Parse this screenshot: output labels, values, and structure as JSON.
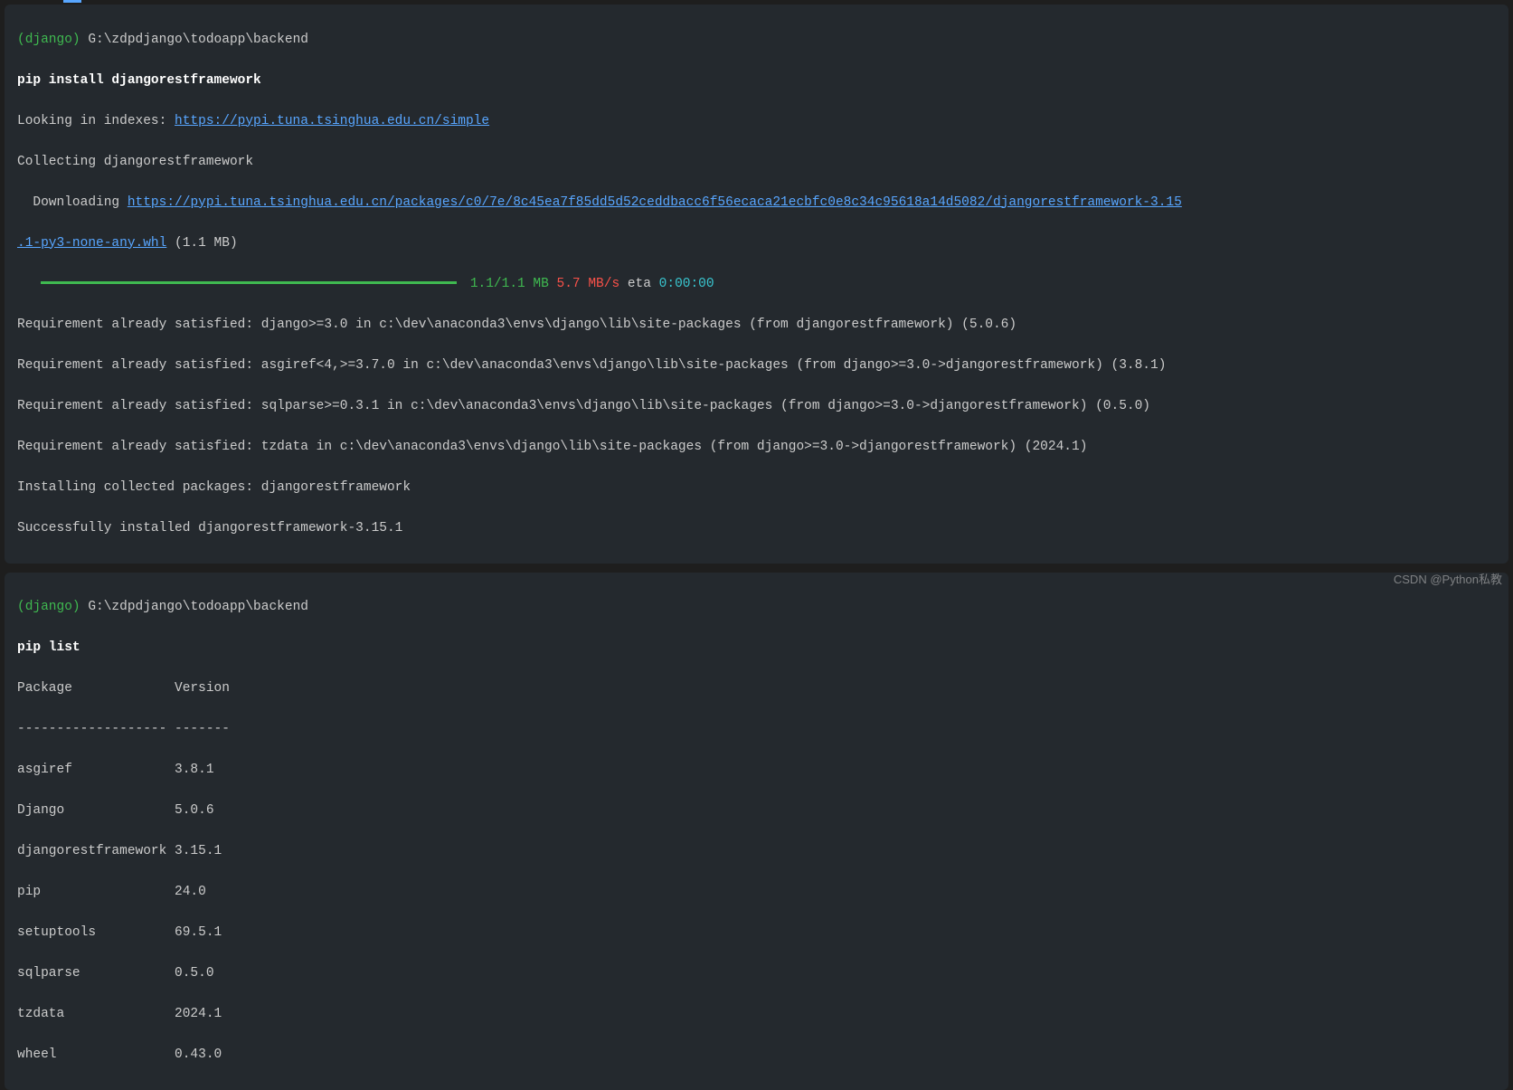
{
  "block1": {
    "env": "(django)",
    "path": " G:\\zdpdjango\\todoapp\\backend",
    "cmd": "pip install djangorestframework",
    "line_lookup": "Looking in indexes: ",
    "url_index": "https://pypi.tuna.tsinghua.edu.cn/simple",
    "line_collect": "Collecting djangorestframework",
    "line_download_prefix": "  Downloading ",
    "url_whl_a": "https://pypi.tuna.tsinghua.edu.cn/packages/c0/7e/8c45ea7f85dd5d52ceddbacc6f56ecaca21ecbfc0e8c34c95618a14d5082/djangorestframework-3.15",
    "url_whl_b": ".1-py3-none-any.whl",
    "whl_size": " (1.1 MB)",
    "progress": {
      "size": "1.1/1.1 MB",
      "speed": "5.7 MB/s",
      "eta_label": " eta ",
      "eta": "0:00:00"
    },
    "req1": "Requirement already satisfied: django>=3.0 in c:\\dev\\anaconda3\\envs\\django\\lib\\site-packages (from djangorestframework) (5.0.6)",
    "req2": "Requirement already satisfied: asgiref<4,>=3.7.0 in c:\\dev\\anaconda3\\envs\\django\\lib\\site-packages (from django>=3.0->djangorestframework) (3.8.1)",
    "req3": "Requirement already satisfied: sqlparse>=0.3.1 in c:\\dev\\anaconda3\\envs\\django\\lib\\site-packages (from django>=3.0->djangorestframework) (0.5.0)",
    "req4": "Requirement already satisfied: tzdata in c:\\dev\\anaconda3\\envs\\django\\lib\\site-packages (from django>=3.0->djangorestframework) (2024.1)",
    "install": "Installing collected packages: djangorestframework",
    "success": "Successfully installed djangorestframework-3.15.1"
  },
  "block2": {
    "env": "(django)",
    "path": " G:\\zdpdjango\\todoapp\\backend",
    "cmd": "pip list",
    "header": "Package             Version",
    "divider": "------------------- -------",
    "rows": [
      "asgiref             3.8.1",
      "Django              5.0.6",
      "djangorestframework 3.15.1",
      "pip                 24.0",
      "setuptools          69.5.1",
      "sqlparse            0.5.0",
      "tzdata              2024.1",
      "wheel               0.43.0"
    ]
  },
  "watermark": "CSDN @Python私教"
}
